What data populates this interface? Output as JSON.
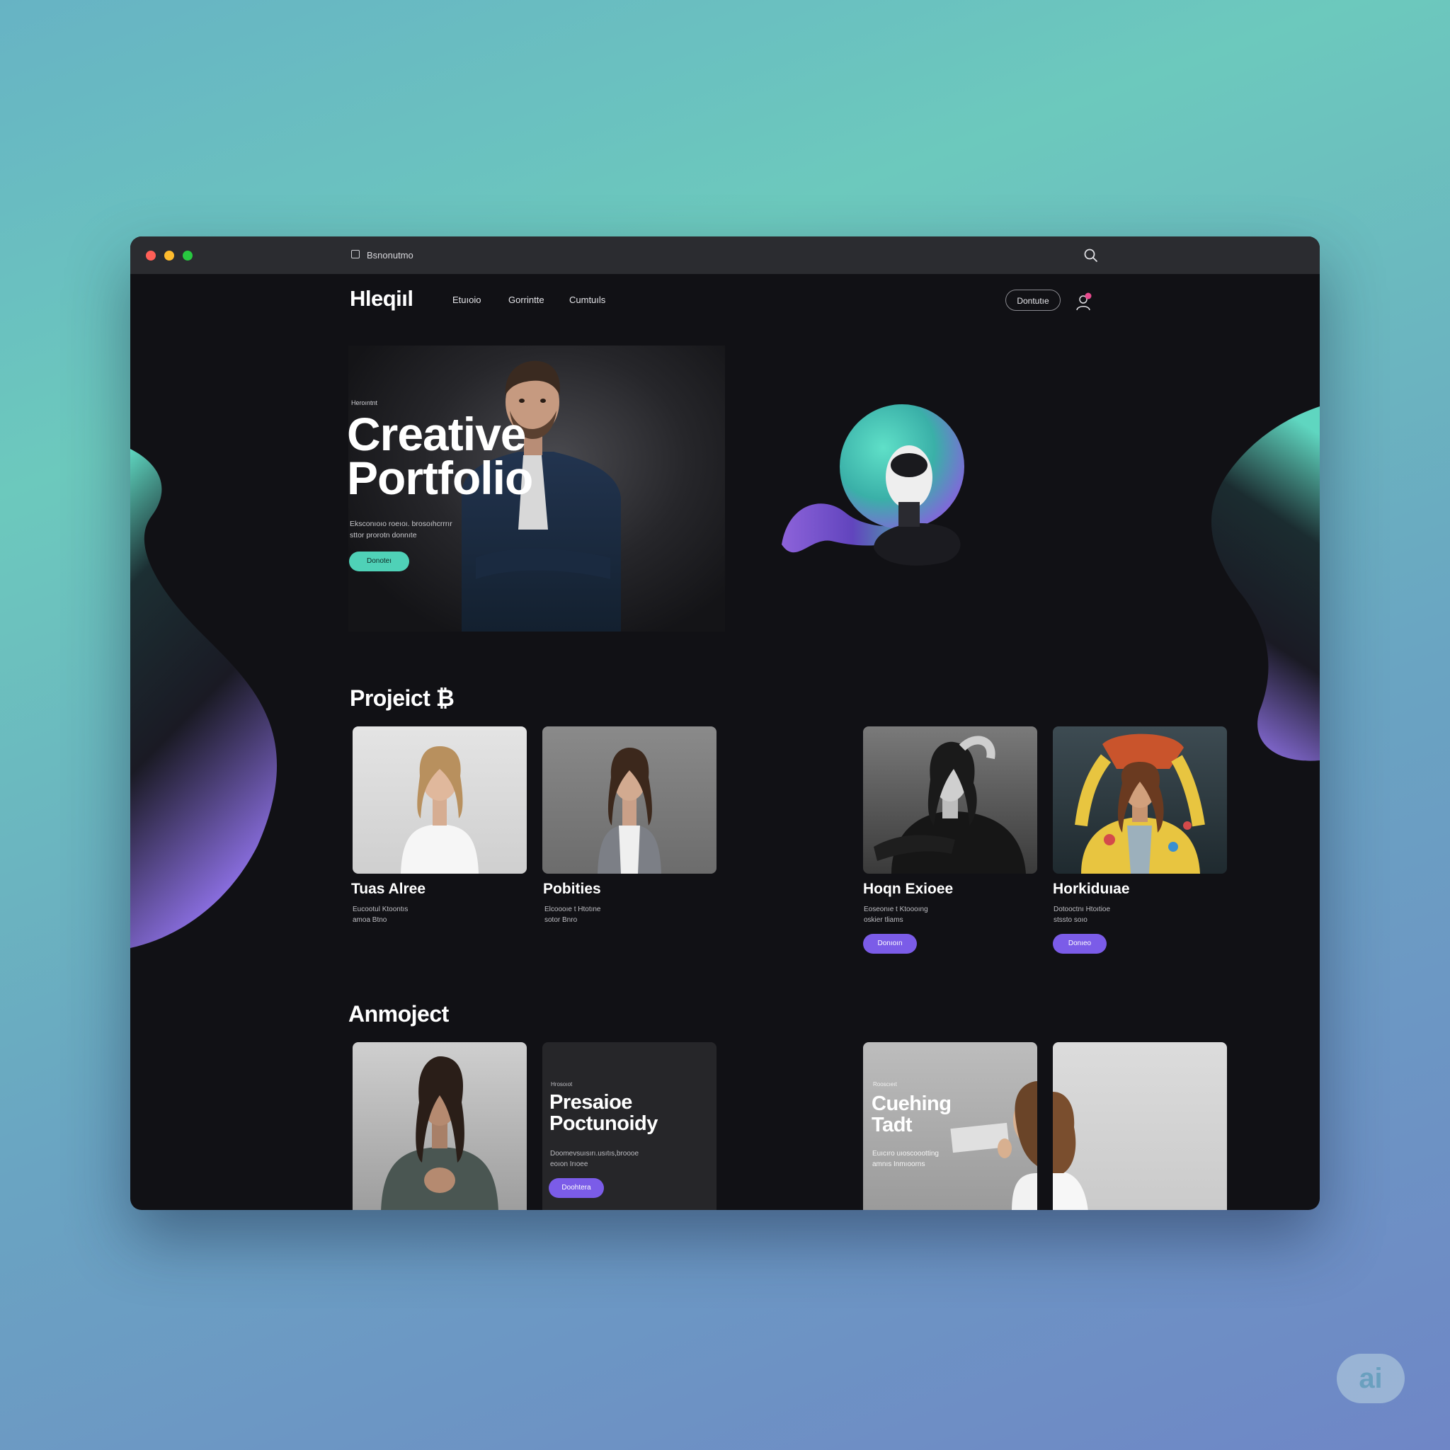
{
  "browser": {
    "tab_title": "Bsnonutmo",
    "traffic_colors": [
      "#ff5f57",
      "#febc2e",
      "#28c840"
    ]
  },
  "nav": {
    "logo": "Hleqiıl",
    "links": [
      "Etuıoio",
      "Gorrintte",
      "Cumtuıls"
    ],
    "button": "Dontutıe"
  },
  "hero": {
    "eyebrow": "Heroıntnt",
    "title_line1": "Creative",
    "title_line2": "Portfolio",
    "desc_line1": "Eksconıoıo roeıoı. brosoıhcrrrır",
    "desc_line2": "sttor prorotn donnıte",
    "button": "Donoteı"
  },
  "projects": {
    "title": "Projeict ₿",
    "cards": [
      {
        "title": "Tuas Alree",
        "desc_line1": "Eucootul Ktoontıs",
        "desc_line2": "amoa Btno",
        "button": ""
      },
      {
        "title": "Pobities",
        "desc_line1": "Elcoooıe t Htotıne",
        "desc_line2": "sotor Bnro",
        "button": ""
      },
      {
        "title": "Hoqn Exioee",
        "desc_line1": "Eoseonıe t Ktoooıng",
        "desc_line2": "oskier tliams",
        "button": "Donıoın"
      },
      {
        "title": "Horkiduıae",
        "desc_line1": "Dotooctnı Htoıtioe",
        "desc_line2": "stssto soıo",
        "button": "Donıeo"
      }
    ]
  },
  "another": {
    "title": "Anmoject",
    "cards": [
      {
        "kind": "photo"
      },
      {
        "kind": "text",
        "eyebrow": "Hrosoıot",
        "title_line1": "Presaioe",
        "title_line2": "Poctunoidy",
        "desc_line1": "Doomevsuısırı.usıtıs,broooe",
        "desc_line2": "eoıon Irıoee",
        "button": "Doohtera"
      },
      {
        "kind": "text-photo",
        "eyebrow": "Rooscıeıt",
        "title_line1": "Cuehing",
        "title_line2": "Tadt",
        "desc_line1": "Euıcıro uıoscoootting",
        "desc_line2": "amnıs Inmıoorns"
      },
      {
        "kind": "photo"
      }
    ]
  },
  "watermark": "ai",
  "colors": {
    "accent_teal": "#4fd1b7",
    "accent_purple": "#7b5ce8",
    "window_bg": "#111115"
  }
}
